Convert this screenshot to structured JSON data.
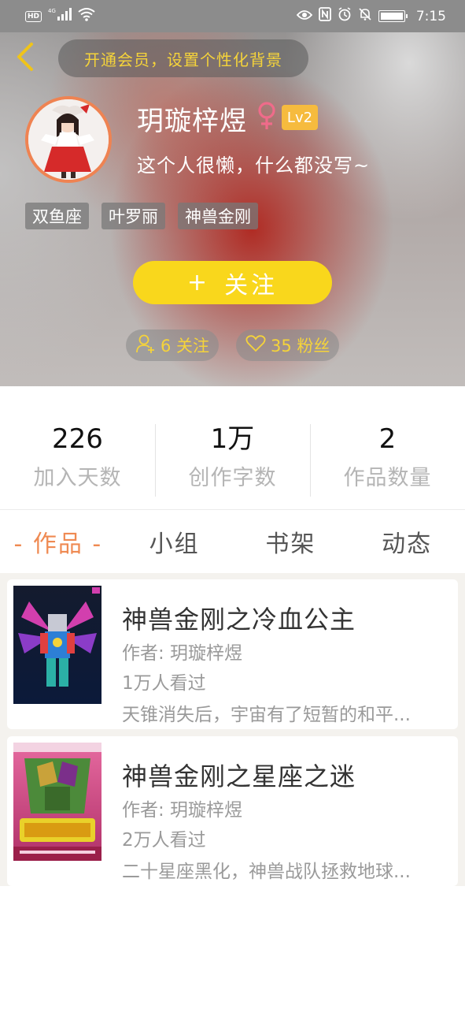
{
  "status_bar": {
    "left_icons": [
      "hd-icon",
      "4g-signal-icon",
      "wifi-icon"
    ],
    "hd": "HD",
    "net": "4G",
    "right_icons": [
      "eye-icon",
      "nfc-icon",
      "alarm-icon",
      "mute-icon",
      "battery-icon"
    ],
    "time": "7:15"
  },
  "header": {
    "back_icon": "chevron-left-icon",
    "member_banner": "开通会员，设置个性化背景",
    "username": "玥璇梓煜",
    "gender_icon": "female-icon",
    "level": "Lv2",
    "bio": "这个人很懒，什么都没写~",
    "tags": [
      "双鱼座",
      "叶罗丽",
      "神兽金刚"
    ],
    "follow_button": {
      "plus": "+",
      "label": "关注"
    },
    "following": {
      "icon": "add-user-icon",
      "label": "6 关注"
    },
    "fans": {
      "icon": "heart-icon",
      "label": "35 粉丝"
    }
  },
  "stats": [
    {
      "value": "226",
      "label": "加入天数"
    },
    {
      "value": "1万",
      "label": "创作字数"
    },
    {
      "value": "2",
      "label": "作品数量"
    }
  ],
  "tabs": [
    {
      "label": "- 作品 -",
      "active": true
    },
    {
      "label": "小组",
      "active": false
    },
    {
      "label": "书架",
      "active": false
    },
    {
      "label": "动态",
      "active": false
    }
  ],
  "works": [
    {
      "title": "神兽金刚之冷血公主",
      "author": "作者: 玥璇梓煜",
      "views": "1万人看过",
      "desc": "天锥消失后，宇宙有了短暂的和平..."
    },
    {
      "title": "神兽金刚之星座之迷",
      "author": "作者: 玥璇梓煜",
      "views": "2万人看过",
      "desc": "二十星座黑化，神兽战队拯救地球..."
    }
  ],
  "colors": {
    "accent_orange": "#ef8a52",
    "follow_yellow": "#f9d71c",
    "member_gold": "#f5d33a",
    "level_badge": "#f6bb3e"
  }
}
